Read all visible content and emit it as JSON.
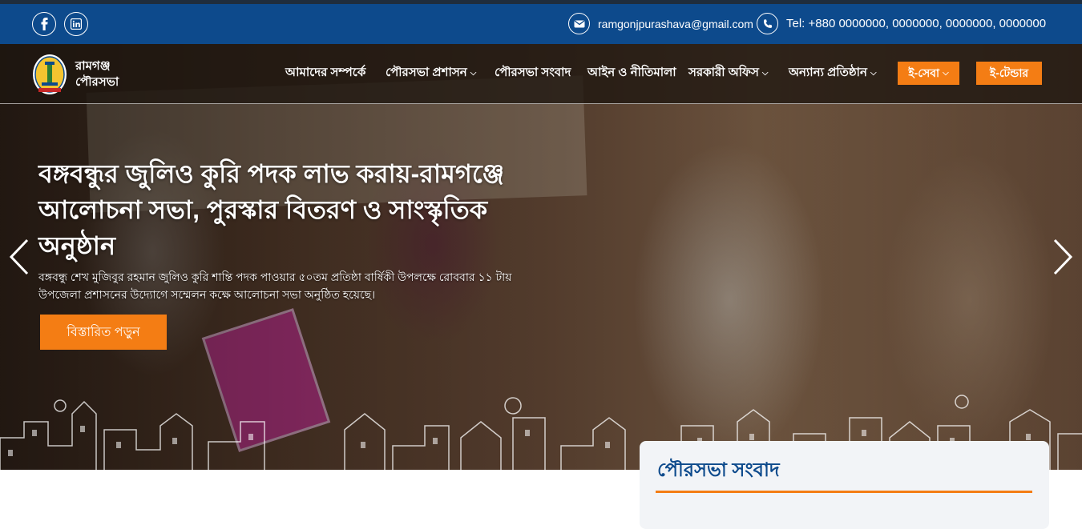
{
  "topbar": {
    "social": [
      "facebook-icon",
      "linkedin-icon"
    ],
    "email": "ramgonjpurashava@gmail.com",
    "phone": "Tel: +880 0000000, 0000000, 0000000, 0000000"
  },
  "brand": {
    "line1": "রামগঞ্জ",
    "line2": "পৌরসভা"
  },
  "nav": {
    "items": [
      {
        "label": "আমাদের সম্পর্কে",
        "dropdown": false
      },
      {
        "label": "পৌরসভা প্রশাসন",
        "dropdown": true
      },
      {
        "label": "পৌরসভা সংবাদ",
        "dropdown": false
      },
      {
        "label": "আইন ও নীতিমালা",
        "dropdown": false
      },
      {
        "label": "সরকারী অফিস",
        "dropdown": true
      },
      {
        "label": "অন্যান্য প্রতিষ্ঠান",
        "dropdown": true
      }
    ],
    "eseba": "ই-সেবা",
    "etender": "ই-টেন্ডার"
  },
  "hero": {
    "title": "বঙ্গবন্ধুর জুলিও কুরি পদক লাভ করায়-রামগঞ্জে আলোচনা সভা, পুরস্কার বিতরণ ও সাংস্কৃতিক অনুষ্ঠান",
    "description": "বঙ্গবন্ধু শেখ মুজিবুর রহমান জুলিও কুরি শান্তি পদক পাওয়ার ৫০তম প্রতিষ্ঠা বার্ষিকী উপলক্ষে রোববার ১১ টায় উপজেলা প্রশাসনের উদ্যোগে সম্মেলন কক্ষে আলোচনা সভা অনুষ্ঠিত হয়েছে।",
    "button": "বিস্তারিত পড়ুন"
  },
  "news_card": {
    "title": "পৌরসভা সংবাদ"
  },
  "colors": {
    "topbar": "#0d4a8c",
    "accent": "#f47d14",
    "navbar": "#1e1610"
  }
}
